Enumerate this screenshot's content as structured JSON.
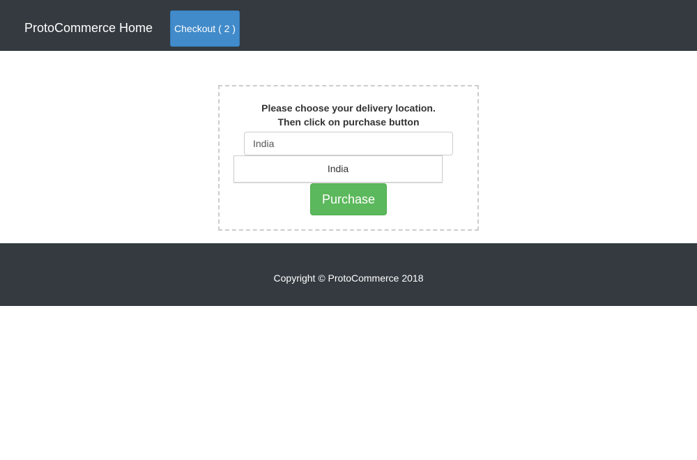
{
  "navbar": {
    "brand": "ProtoCommerce Home",
    "checkout_label": "Checkout ( 2 )"
  },
  "delivery": {
    "instruction_line1": "Please choose your delivery location.",
    "instruction_line2": "Then click on purchase button",
    "country_input_value": "India",
    "suggestions": [
      "India"
    ],
    "purchase_label": "Purchase"
  },
  "footer": {
    "copyright": "Copyright © ProtoCommerce 2018"
  },
  "colors": {
    "navbar_bg": "#343a40",
    "checkout_btn": "#428bca",
    "purchase_btn": "#5cb85c",
    "footer_bg": "#343a40"
  }
}
